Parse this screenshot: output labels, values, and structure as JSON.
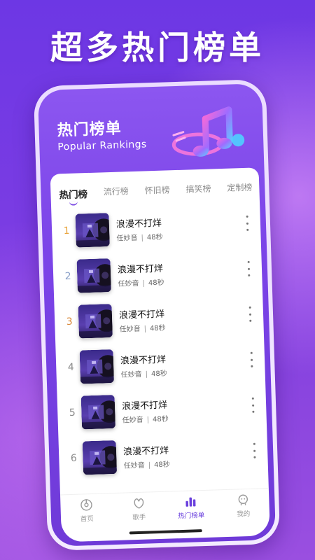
{
  "headline": "超多热门榜单",
  "banner": {
    "title": "热门榜单",
    "subtitle": "Popular Rankings"
  },
  "tabs": [
    {
      "label": "热门榜",
      "active": true
    },
    {
      "label": "流行榜",
      "active": false
    },
    {
      "label": "怀旧榜",
      "active": false
    },
    {
      "label": "搞笑榜",
      "active": false
    },
    {
      "label": "定制榜",
      "active": false
    }
  ],
  "songs": [
    {
      "rank": "1",
      "title": "浪漫不打烊",
      "artist": "任妙音",
      "duration": "48秒"
    },
    {
      "rank": "2",
      "title": "浪漫不打烊",
      "artist": "任妙音",
      "duration": "48秒"
    },
    {
      "rank": "3",
      "title": "浪漫不打烊",
      "artist": "任妙音",
      "duration": "48秒"
    },
    {
      "rank": "4",
      "title": "浪漫不打烊",
      "artist": "任妙音",
      "duration": "48秒"
    },
    {
      "rank": "5",
      "title": "浪漫不打烊",
      "artist": "任妙音",
      "duration": "48秒"
    },
    {
      "rank": "6",
      "title": "浪漫不打烊",
      "artist": "任妙音",
      "duration": "48秒"
    }
  ],
  "rank_colors": {
    "1": "#e8a33a",
    "2": "#8aa0c8",
    "3": "#d98a3c",
    "default": "#8c8c8c"
  },
  "bottom_nav": [
    {
      "label": "首页",
      "icon": "disc-icon",
      "active": false
    },
    {
      "label": "歌手",
      "icon": "singer-icon",
      "active": false
    },
    {
      "label": "热门榜单",
      "icon": "chart-bars-icon",
      "active": true
    },
    {
      "label": "我的",
      "icon": "profile-icon",
      "active": false
    }
  ],
  "colors": {
    "accent": "#6a40dd",
    "background": "#7a3ce3"
  }
}
